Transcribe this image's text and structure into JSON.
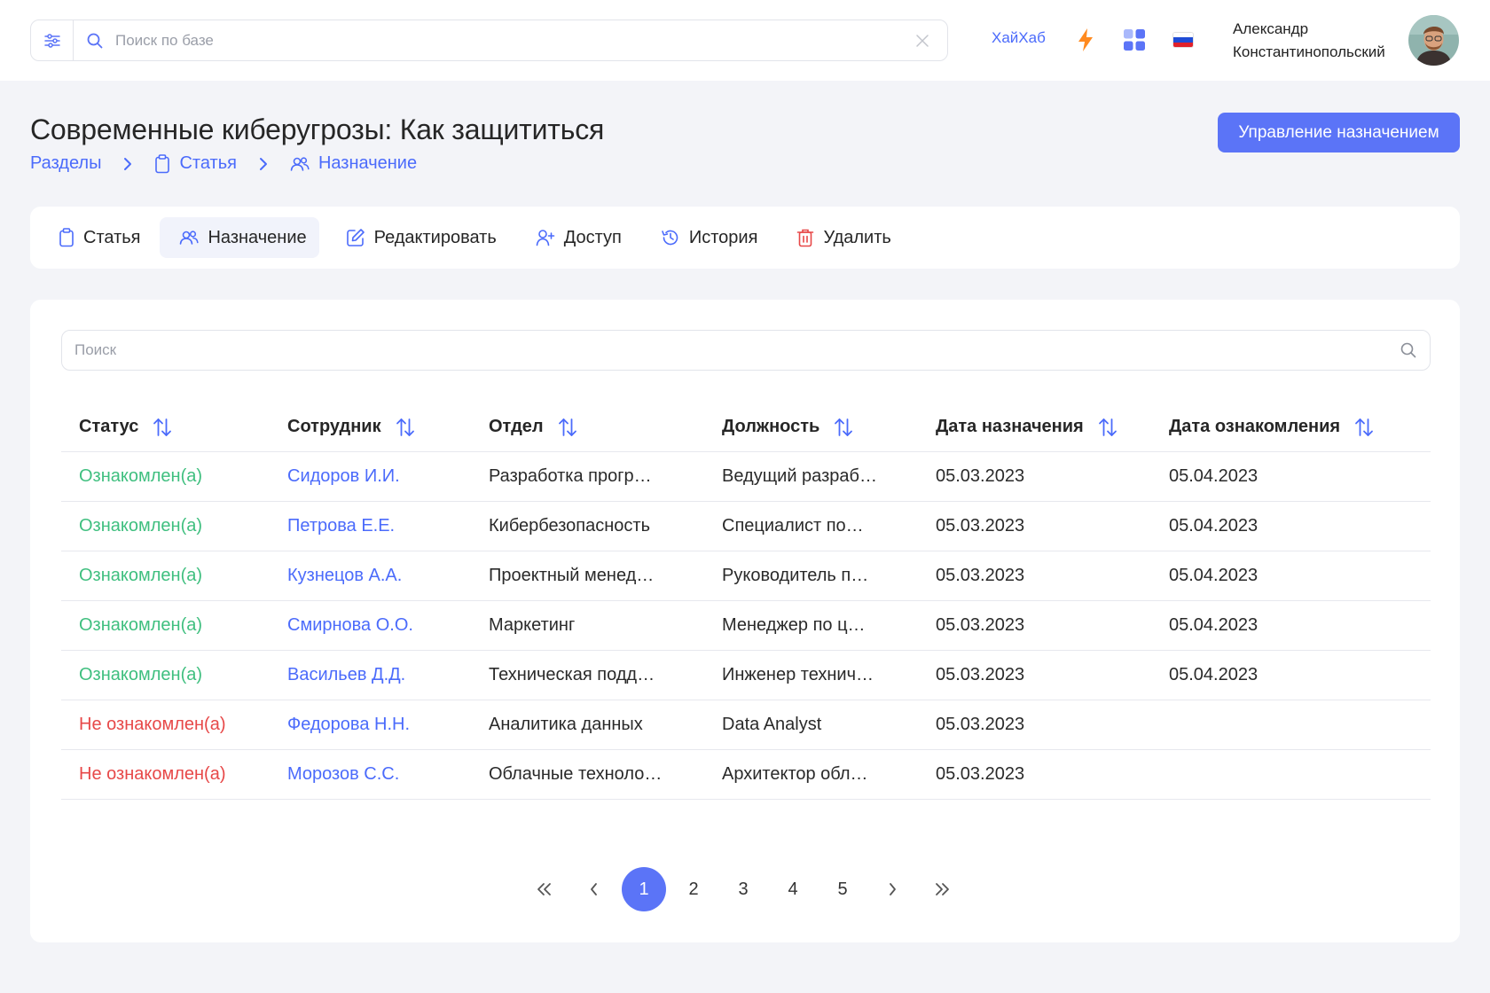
{
  "header": {
    "search_placeholder": "Поиск по базе",
    "brand": "ХайХаб",
    "user_name_line1": "Александр",
    "user_name_line2": "Константинопольский"
  },
  "page": {
    "title": "Современные киберугрозы: Как защититься",
    "manage_button": "Управление назначением"
  },
  "breadcrumb": [
    "Разделы",
    "Статья",
    "Назначение"
  ],
  "tabs": [
    {
      "label": "Статья",
      "icon": "clipboard-icon"
    },
    {
      "label": "Назначение",
      "icon": "users-icon",
      "active": true
    },
    {
      "label": "Редактировать",
      "icon": "edit-icon"
    },
    {
      "label": "Доступ",
      "icon": "user-plus-icon"
    },
    {
      "label": "История",
      "icon": "history-icon"
    },
    {
      "label": "Удалить",
      "icon": "trash-icon"
    }
  ],
  "table": {
    "search_placeholder": "Поиск",
    "columns": [
      "Статус",
      "Сотрудник",
      "Отдел",
      "Должность",
      "Дата назначения",
      "Дата ознакомления"
    ],
    "rows": [
      {
        "status": "Ознакомлен(а)",
        "status_type": "ok",
        "employee": "Сидоров И.И.",
        "department": "Разработка прогр…",
        "position": "Ведущий разраб…",
        "assigned": "05.03.2023",
        "acknowledged": "05.04.2023"
      },
      {
        "status": "Ознакомлен(а)",
        "status_type": "ok",
        "employee": "Петрова Е.Е.",
        "department": "Кибербезопасность",
        "position": "Специалист по…",
        "assigned": "05.03.2023",
        "acknowledged": "05.04.2023"
      },
      {
        "status": "Ознакомлен(а)",
        "status_type": "ok",
        "employee": "Кузнецов А.А.",
        "department": "Проектный менед…",
        "position": "Руководитель п…",
        "assigned": "05.03.2023",
        "acknowledged": "05.04.2023"
      },
      {
        "status": "Ознакомлен(а)",
        "status_type": "ok",
        "employee": "Смирнова О.О.",
        "department": "Маркетинг",
        "position": "Менеджер по ц…",
        "assigned": "05.03.2023",
        "acknowledged": "05.04.2023"
      },
      {
        "status": "Ознакомлен(а)",
        "status_type": "ok",
        "employee": "Васильев Д.Д.",
        "department": "Техническая подд…",
        "position": "Инженер технич…",
        "assigned": "05.03.2023",
        "acknowledged": "05.04.2023"
      },
      {
        "status": "Не ознакомлен(а)",
        "status_type": "no",
        "employee": "Федорова Н.Н.",
        "department": "Аналитика данных",
        "position": "Data Analyst",
        "assigned": "05.03.2023",
        "acknowledged": ""
      },
      {
        "status": "Не ознакомлен(а)",
        "status_type": "no",
        "employee": "Морозов С.С.",
        "department": "Облачные техноло…",
        "position": "Архитектор обл…",
        "assigned": "05.03.2023",
        "acknowledged": ""
      }
    ]
  },
  "pagination": {
    "pages": [
      "1",
      "2",
      "3",
      "4",
      "5"
    ],
    "current": "1"
  },
  "colors": {
    "accent": "#5b74f7",
    "link": "#4b6bfb",
    "status_ok": "#3fbf7f",
    "status_no": "#e74848",
    "bolt": "#ff8a1f"
  }
}
